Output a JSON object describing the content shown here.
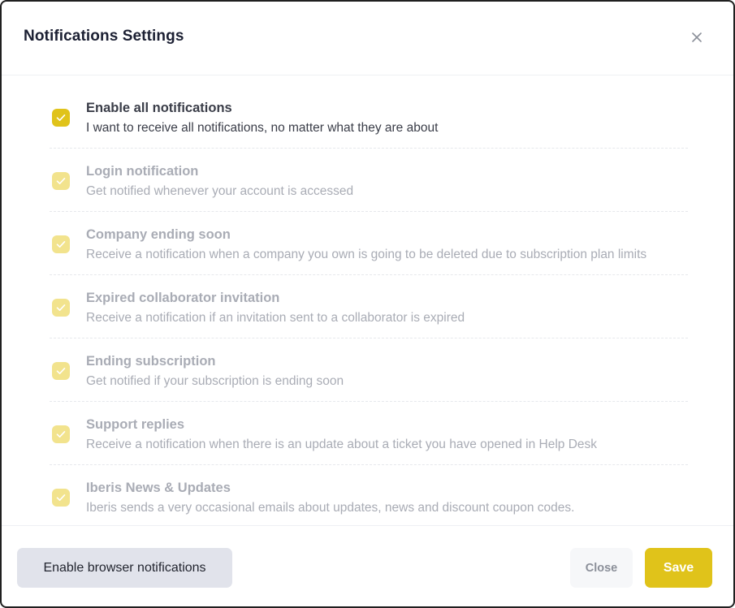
{
  "modal": {
    "title": "Notifications Settings"
  },
  "options": [
    {
      "title": "Enable all notifications",
      "description": "I want to receive all notifications, no matter what they are about",
      "checked": true,
      "disabled": false
    },
    {
      "title": "Login notification",
      "description": "Get notified whenever your account is accessed",
      "checked": true,
      "disabled": true
    },
    {
      "title": "Company ending soon",
      "description": "Receive a notification when a company you own is going to be deleted due to subscription plan limits",
      "checked": true,
      "disabled": true
    },
    {
      "title": "Expired collaborator invitation",
      "description": "Receive a notification if an invitation sent to a collaborator is expired",
      "checked": true,
      "disabled": true
    },
    {
      "title": "Ending subscription",
      "description": "Get notified if your subscription is ending soon",
      "checked": true,
      "disabled": true
    },
    {
      "title": "Support replies",
      "description": "Receive a notification when there is an update about a ticket you have opened in Help Desk",
      "checked": true,
      "disabled": true
    },
    {
      "title": "Iberis News & Updates",
      "description": "Iberis sends a very occasional emails about updates, news and discount coupon codes.",
      "checked": true,
      "disabled": true
    }
  ],
  "footer": {
    "browser_notifications_label": "Enable browser notifications",
    "close_label": "Close",
    "save_label": "Save"
  },
  "colors": {
    "accent": "#e0c31a",
    "accent_disabled": "#f2e38d",
    "text_primary": "#3a3d48",
    "text_disabled": "#a9acb5"
  },
  "icons": {
    "close": "close-icon",
    "check": "check-icon"
  }
}
